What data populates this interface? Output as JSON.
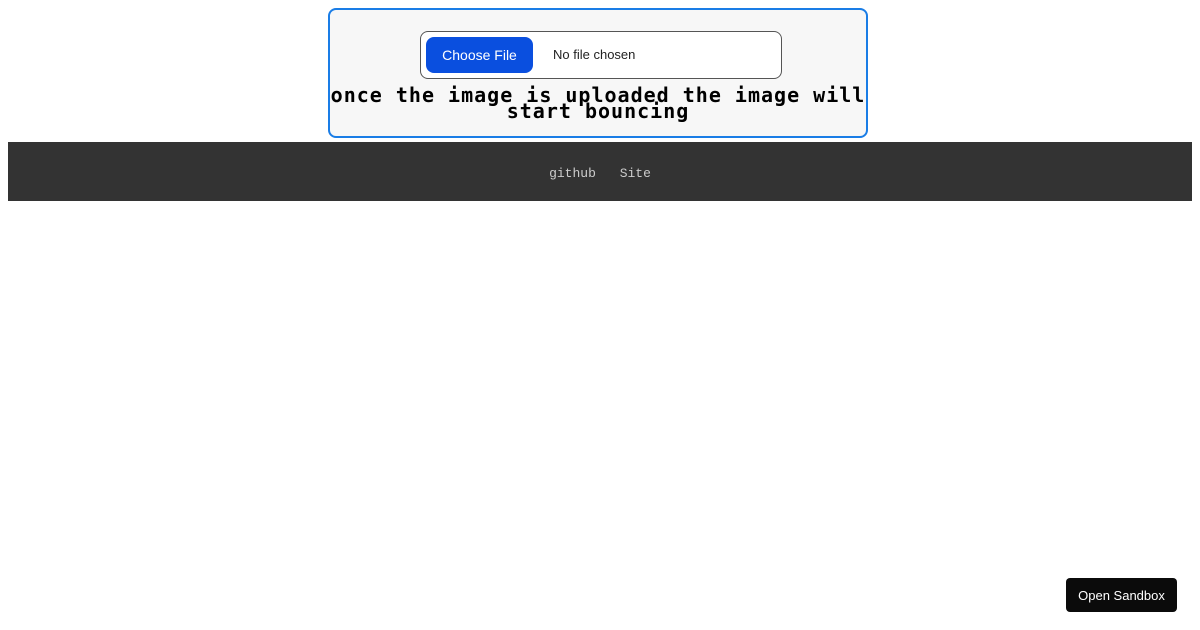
{
  "upload": {
    "choose_label": "Choose File",
    "file_status": "No file chosen",
    "caption": "once the image is uploaded the image will start bouncing"
  },
  "footer": {
    "links": [
      {
        "label": "github"
      },
      {
        "label": "Site"
      }
    ]
  },
  "sandbox": {
    "label": "Open Sandbox"
  },
  "colors": {
    "card_border": "#1a7de6",
    "card_background": "#f7f7f7",
    "choose_button": "#0a4fdf",
    "footer_background": "#333333",
    "footer_link": "#cccccc",
    "sandbox_button": "#0b0b0b"
  }
}
